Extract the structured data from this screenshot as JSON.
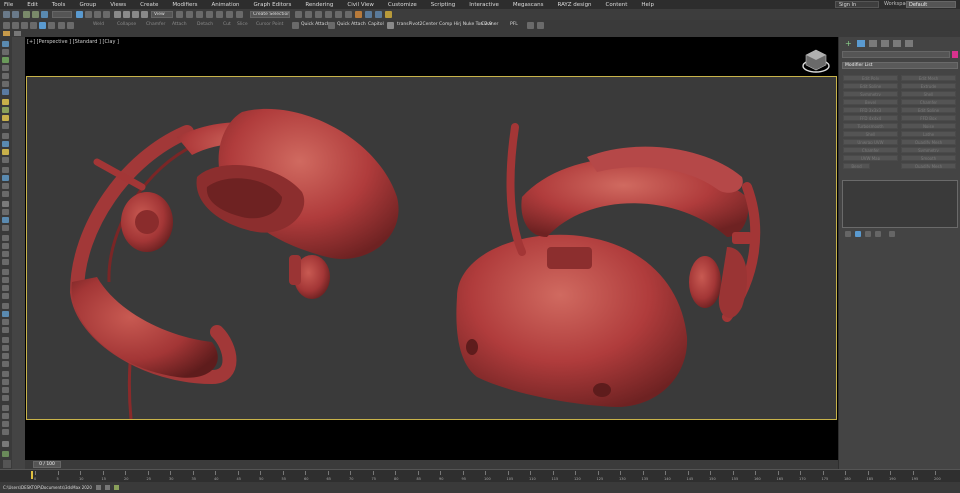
{
  "menu": [
    "File",
    "Edit",
    "Tools",
    "Group",
    "Views",
    "Create",
    "Modifiers",
    "Animation",
    "Graph Editors",
    "Rendering",
    "Civil View",
    "Customize",
    "Scripting",
    "Interactive",
    "Megascans",
    "RAYZ design",
    "Content",
    "Help"
  ],
  "signin": {
    "label": "Sign In"
  },
  "workspace": {
    "label": "Workspaces:",
    "value": "Default"
  },
  "toolbar1": {
    "view_dropdown": "View",
    "selection_set": "Create Selection Se"
  },
  "toolbar2": {
    "items_dim": [
      "Weld",
      "Collapse",
      "Chamfer",
      "Attach",
      "Detach",
      "Cut",
      "Slice",
      "Quickslice"
    ],
    "cut_cursor": "Cursor Point",
    "quick_attach": "Quick Attach",
    "quick_attach2": "Quick Attach",
    "capitol": "Capitol",
    "script_name": "transPivot2Center Comp Hirj Nuke Ton 2.9",
    "cleaner": "Cleaner",
    "pfl": "PFL"
  },
  "viewport": {
    "label": "[+] [Perspective ] [Standard ] [Clay ]"
  },
  "rightpanel": {
    "modifier_list": "Modifier List",
    "buttons_left": [
      "Edit Poly",
      "Edit Spline",
      "Symmetry",
      "Bevel",
      "FFD 3x3x3",
      "FFD 4x4x4",
      "Turbosmooth",
      "Shell",
      "Unwrap UVW",
      "Chamfer",
      "UVW Map",
      "Bend"
    ],
    "buttons_right": [
      "Edit Mesh",
      "Extrude",
      "Shell",
      "Chamfer",
      "Edit Spline",
      "FFD Box",
      "Noise",
      "Lathe",
      "Quadify Mesh",
      "Symmetry",
      "Smooth",
      "Quadify Mesh"
    ]
  },
  "timeline": {
    "frame_label": "0 / 100",
    "ticks": [
      "0",
      "5",
      "10",
      "15",
      "20",
      "25",
      "30",
      "35",
      "40",
      "45",
      "50",
      "55",
      "60",
      "65",
      "70",
      "75",
      "80",
      "85",
      "90",
      "95",
      "100",
      "105",
      "110",
      "115",
      "120",
      "125",
      "130",
      "135",
      "140",
      "145",
      "150",
      "155",
      "160",
      "165",
      "170",
      "175",
      "180",
      "185",
      "190",
      "195",
      "200"
    ]
  },
  "status": {
    "path": "C:\\Users\\DESKTOP\\Documents\\3dsMax 2020"
  },
  "colors": {
    "model": "#b03c3c",
    "viewport_border": "#c8b34a",
    "accent_pink": "#d8328d"
  }
}
